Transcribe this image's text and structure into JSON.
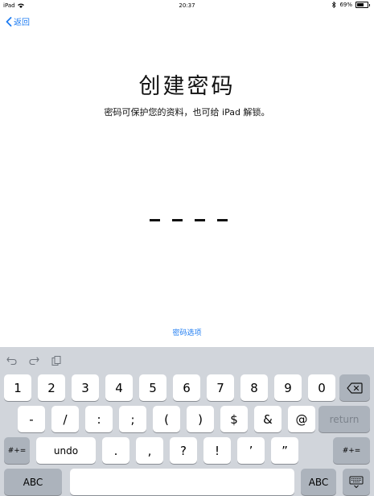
{
  "status": {
    "device": "iPad",
    "time": "20:37",
    "battery": "69%",
    "battery_level": 0.69
  },
  "nav": {
    "back_label": "返回"
  },
  "title": "创建密码",
  "subtitle": "密码可保护您的资料，也可给 iPad 解锁。",
  "passcode": {
    "length": 4
  },
  "options_link": "密码选项",
  "keyboard": {
    "row1": [
      "1",
      "2",
      "3",
      "4",
      "5",
      "6",
      "7",
      "8",
      "9",
      "0"
    ],
    "row2": [
      "-",
      "/",
      ":",
      ";",
      "(",
      ")",
      "$",
      "&",
      "@"
    ],
    "return_label": "return",
    "row3_left": "#+=",
    "undo_label": "undo",
    "row3": [
      ".",
      ",",
      "?",
      "!",
      "’",
      "”"
    ],
    "row3_right": "#+=",
    "abc_left": "ABC",
    "abc_right": "ABC"
  }
}
